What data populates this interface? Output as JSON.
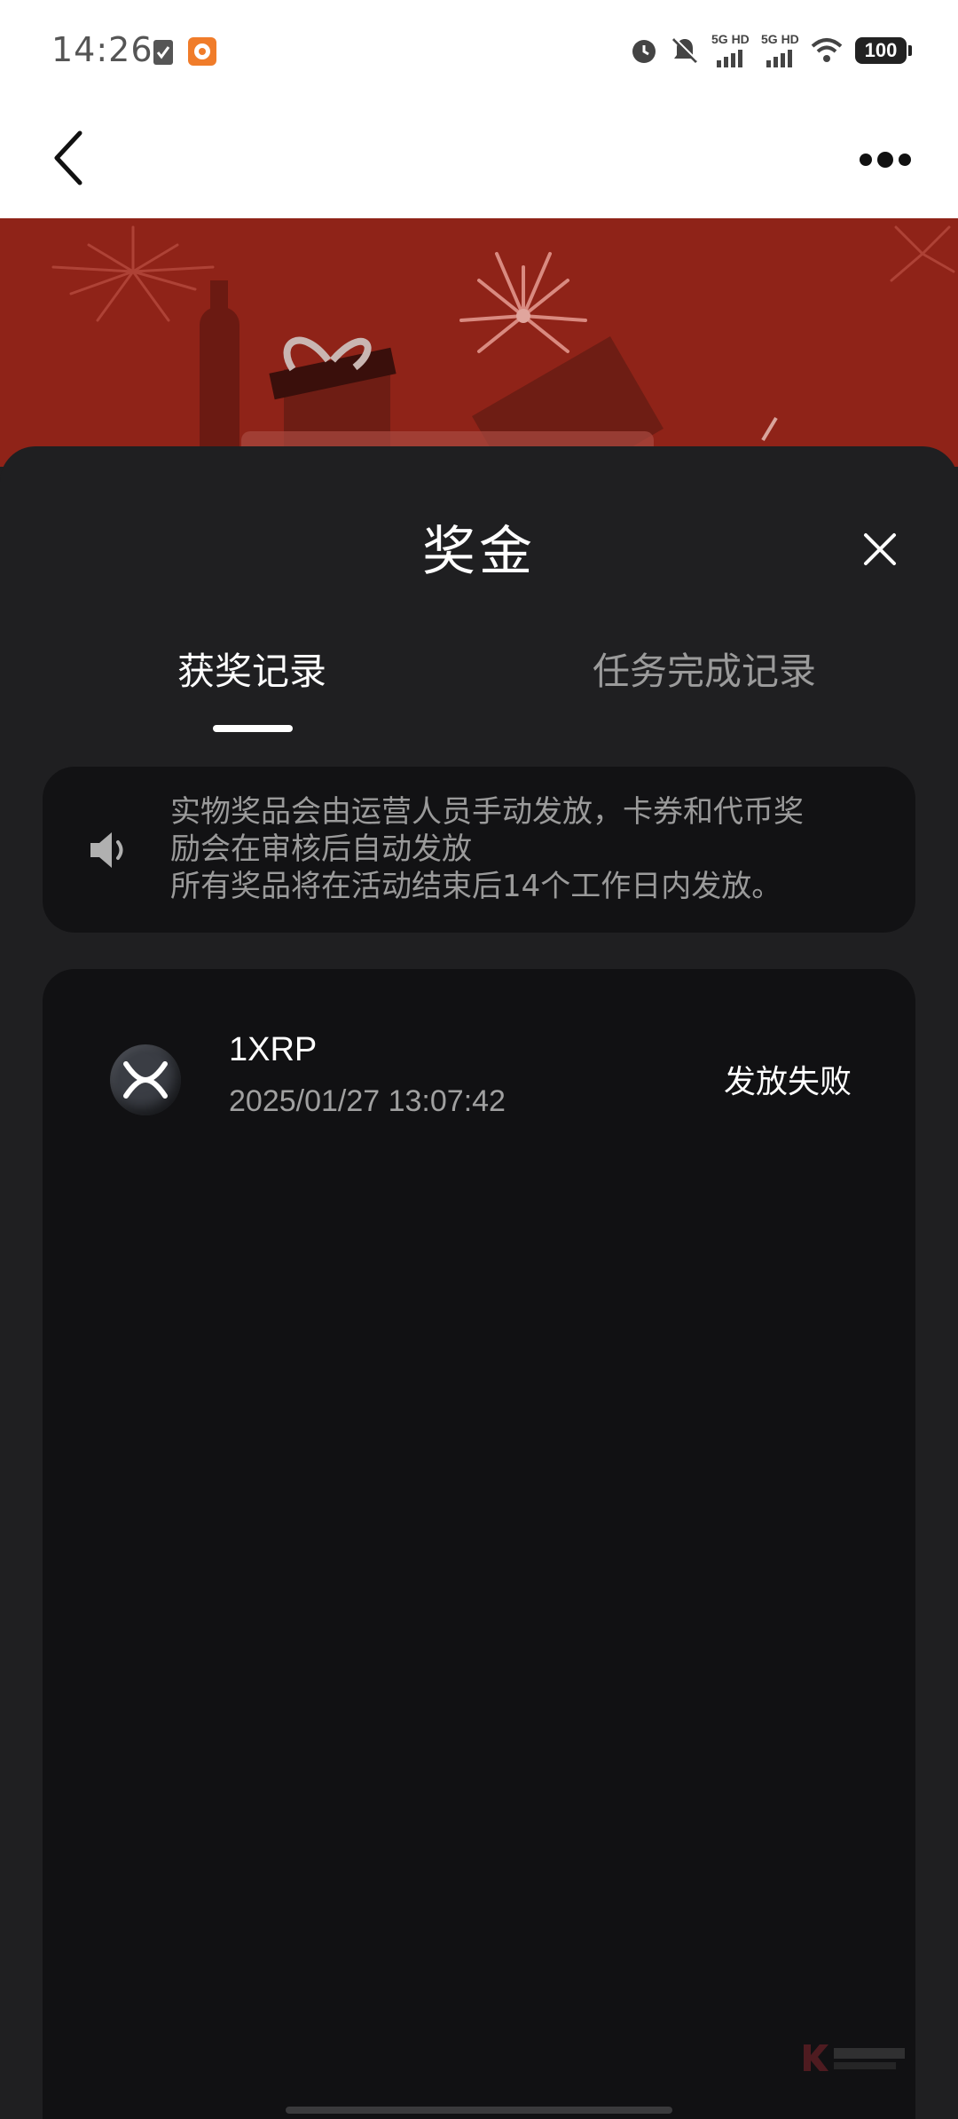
{
  "status_bar": {
    "time": "14:26",
    "signal1_label": "5G HD",
    "signal2_label": "5G HD",
    "battery": "100"
  },
  "nav": {
    "back_icon": "chevron-left-icon",
    "more_icon": "more-dots-icon"
  },
  "sheet": {
    "title": "奖金",
    "tabs": [
      {
        "label": "获奖记录",
        "active": true
      },
      {
        "label": "任务完成记录",
        "active": false
      }
    ],
    "notice": {
      "lines": [
        "实物奖品会由运营人员手动发放，卡券和代币奖",
        "励会在审核后自动发放",
        "所有奖品将在活动结束后14个工作日内发放。"
      ]
    },
    "records": [
      {
        "amount": "1XRP",
        "time": "2025/01/27 13:07:42",
        "status": "发放失败",
        "icon": "xrp-coin-icon"
      }
    ]
  },
  "colors": {
    "banner": "#8f2318",
    "sheet_bg": "#1f1f21",
    "card_bg": "#111113",
    "text_primary": "#ffffff",
    "text_secondary": "#9a9a9a"
  }
}
